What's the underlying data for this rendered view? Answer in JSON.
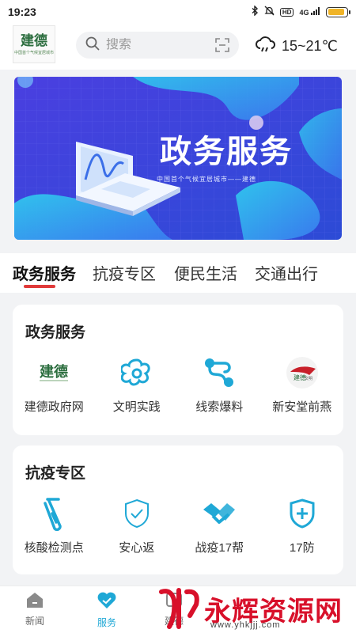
{
  "status": {
    "time": "19:23",
    "hd": "HD",
    "net": "4G",
    "battery_level": 0.9
  },
  "header": {
    "logo_text": "建德",
    "logo_sub": "中国首个气候宜居城市",
    "search_placeholder": "搜索",
    "weather_temp": "15~21℃",
    "weather_icon": "cloud-icon"
  },
  "banner": {
    "title": "政务服务",
    "subtitle": "中国首个气候宜居城市——建德"
  },
  "tabs": [
    {
      "label": "政务服务",
      "active": true
    },
    {
      "label": "抗疫专区"
    },
    {
      "label": "便民生活"
    },
    {
      "label": "交通出行"
    }
  ],
  "sections": [
    {
      "title": "政务服务",
      "items": [
        {
          "label": "建德政府网",
          "icon": "jiande-logo-icon"
        },
        {
          "label": "文明实践",
          "icon": "flower-icon"
        },
        {
          "label": "线索爆料",
          "icon": "route-icon"
        },
        {
          "label": "新安堂前燕",
          "icon": "tangqianyan-logo-icon"
        }
      ]
    },
    {
      "title": "抗疫专区",
      "items": [
        {
          "label": "核酸检测点",
          "icon": "test-tube-icon"
        },
        {
          "label": "安心返",
          "icon": "shield-check-icon"
        },
        {
          "label": "战疫17帮",
          "icon": "handshake-icon"
        },
        {
          "label": "17防",
          "icon": "medical-shield-icon"
        }
      ]
    }
  ],
  "bottom_nav": [
    {
      "label": "新闻",
      "icon": "home-icon"
    },
    {
      "label": "服务",
      "icon": "heart-icon",
      "active": true
    },
    {
      "label": "建德",
      "icon": "jiande-icon"
    }
  ],
  "watermark": {
    "text": "永辉资源网",
    "url": "www.yhkjjj.com"
  },
  "colors": {
    "accent": "#1fa8d6",
    "tab_underline": "#e03a3a",
    "banner_bg": "#3540d8"
  }
}
